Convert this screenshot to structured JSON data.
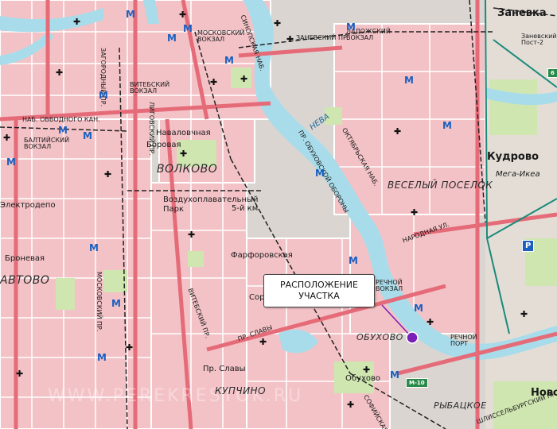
{
  "map": {
    "districts": {
      "volkovo": "ВОЛКОВО",
      "vesely": "ВЕСЕЛЫЙ ПОСЕЛОК",
      "kupchino": "КУПЧИНО",
      "obukhovo": "ОБУХОВО",
      "rybatskoe": "РЫБАЦКОЕ",
      "kudrovo": "Кудрово",
      "zanevka": "Заневка",
      "novo": "Ново",
      "artovo": "АВТОВО"
    },
    "stations": {
      "moskovsky_vokzal": "МОСКОВСКИЙ ВОКЗАЛ",
      "ladozhsky_vokzal": "ЛАДОЖСКИЙ ВОКЗАЛ",
      "vitebsky_vokzal": "ВИТЕБСКИЙ ВОКЗАЛ",
      "baltiysky_vokzal": "БАЛТИЙСКИЙ ВОКЗАЛ",
      "zanevsky_post": "Заневский Пост-2",
      "navalochnaya": "Наваловчная",
      "borovaya": "Боровая",
      "vozdukh": "Воздухоплавательный Парк",
      "km5": "5-й км",
      "farforovskaya": "Фарфоровская",
      "sortirovochnaya": "Сорт",
      "rechnoy_vokzal": "РЕЧНОЙ ВОКЗАЛ",
      "obukhovo_st": "Обухово",
      "pr_slavy": "Пр. Славы",
      "elektrodepo": "Электродепо",
      "bronevaya": "Броневая",
      "rechnoy_port": "РЕЧНОЙ ПОРТ",
      "mega_ikea": "Мега-Икеа"
    },
    "streets": {
      "obvodny": "НАБ. ОБВОДНОГО КАН.",
      "zagorodny": "ЗАГОРОДНЫЙ ПР.",
      "ligovsky": "ЛИГОВСКИЙ ПР.",
      "oktyabrskaya": "ОКТЯБРЬСКАЯ НАБ.",
      "obukhovskoy": "ПР. ОБУХОВСКОЙ ОБОРОНЫ",
      "narodnaya": "НАРОДНАЯ УЛ.",
      "moskovsky_pr": "МОСКОВСКИЙ ПР.",
      "vitebsky_pr": "ВИТЕБСКИЙ ПР.",
      "pr_slavy_st": "ПР. СЛАВЫ",
      "zanevsky": "ЗАНЕВСКИЙ ПР.",
      "sofiyskaya": "СОФИЙСКАЯ УЛ.",
      "shlisselburgsky": "ШЛИССЕЛЬБУРГСКИЙ ПР.",
      "sinopskaya": "СИНОПСКАЯ НАБ.",
      "m10": "М-10",
      "ring": "6"
    },
    "river": "НЕВА",
    "callout": {
      "line1": "РАСПОЛОЖЕНИЕ",
      "line2": "УЧАСТКА"
    },
    "watermark": "WWW.PEREKRESTOK.RU",
    "metro_symbol": "M",
    "church_symbol": "✚",
    "parking_symbol": "P",
    "colors": {
      "blocks": "#f3c2c6",
      "streets": "#ffffff",
      "major_roads": "#e56b78",
      "water": "#a9dcea",
      "parks": "#cfe6b0",
      "railway": "#222222",
      "metro": "#1a5fbf",
      "marker": "#7a1fb8",
      "ring_road": "#1a8a7a"
    }
  }
}
